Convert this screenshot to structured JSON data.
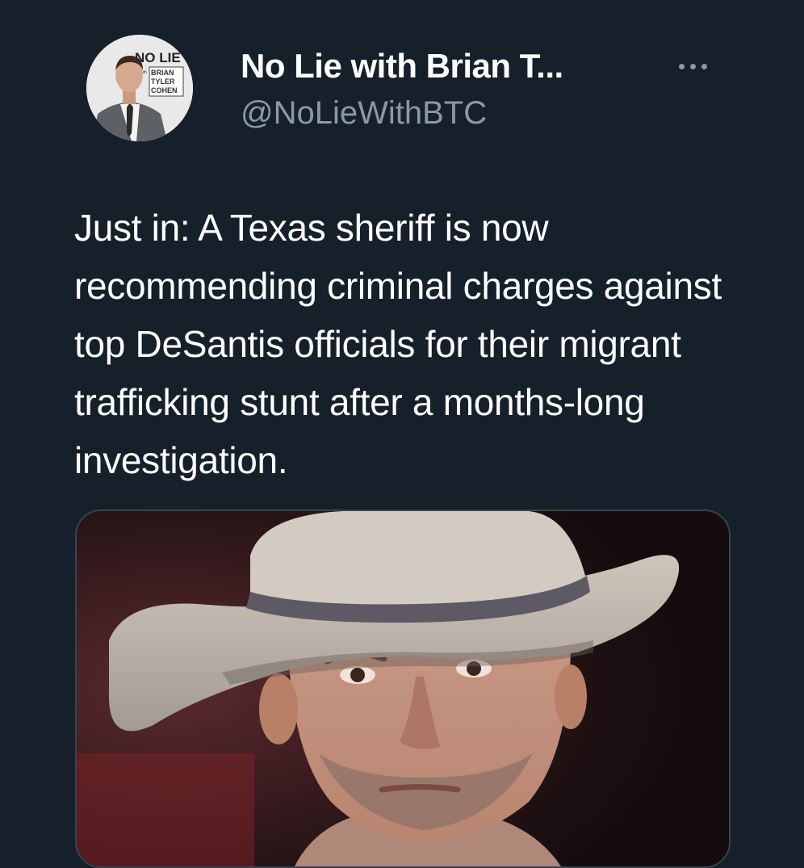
{
  "tweet": {
    "author": {
      "display_name": "No Lie with Brian T...",
      "handle": "@NoLieWithBTC",
      "avatar_logo_text": "NO LIE with BRIAN TYLER COHEN"
    },
    "text": "Just in: A Texas sheriff is now recommending criminal charges against top DeSantis officials for their migrant trafficking stunt after a months-long investigation.",
    "media": {
      "type": "photo",
      "subject": "man-in-cowboy-hat"
    }
  },
  "colors": {
    "background": "#15202b",
    "primary_text": "#ffffff",
    "secondary_text": "#8b98a5",
    "card_border": "#38444d"
  },
  "icons": {
    "more": "more-horizontal-icon"
  }
}
